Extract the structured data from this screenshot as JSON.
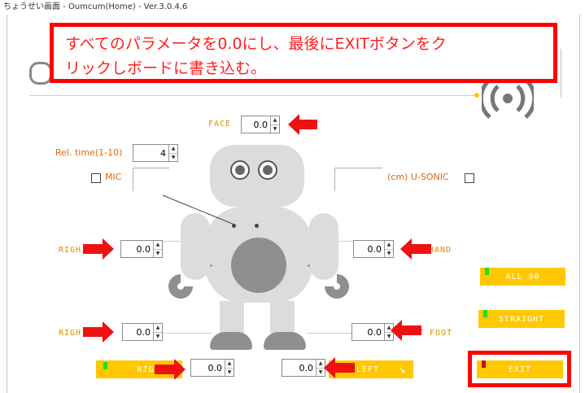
{
  "window": {
    "title": "ちょうせい画面 - Oumcum(Home) - Ver.3.0.4.6"
  },
  "callout": {
    "line1": "すべてのパラメータを0.0にし、最後にEXITボタンをク",
    "line2": "リックしボードに書き込む。"
  },
  "face": {
    "label": "FACE",
    "value": "0.0"
  },
  "rel_time": {
    "label": "Rel. time(1-10)",
    "value": "4"
  },
  "mic": {
    "label": "MIC"
  },
  "usonic": {
    "label": "(cm) U-SONIC"
  },
  "right_hand": {
    "label": "RIGH",
    "value": "0.0"
  },
  "left_hand": {
    "label": "HAND",
    "value": "0.0"
  },
  "right_foot": {
    "label": "RIGH",
    "value": "0.0"
  },
  "left_foot": {
    "label": "T FOOT",
    "value": "0.0"
  },
  "right_turn": {
    "label": "RIGHT",
    "value": "0.0"
  },
  "left_turn": {
    "label": "LEFT",
    "value": "0.0"
  },
  "buttons": {
    "all90": "ALL 90",
    "straight": "STRAIGHT",
    "exit": "EXIT"
  },
  "colors": {
    "accent": "#ff0000",
    "button": "#ffc800",
    "label": "#e08a00",
    "robot": "#dcdcdc"
  }
}
